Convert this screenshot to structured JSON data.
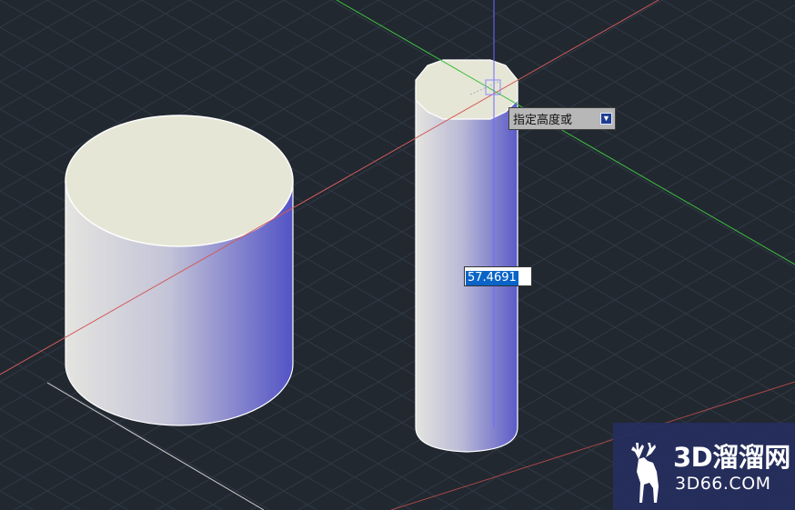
{
  "app": {
    "name": "AutoCAD 3D model space"
  },
  "command": {
    "prompt_label": "指定高度或",
    "prompt_options_icon": "chevron-down-icon",
    "height_value": "57.4691"
  },
  "scene": {
    "background_color": "#212830",
    "axis_x_color": "#d35a5a",
    "axis_y_color": "#3fbf3f",
    "axis_z_color": "#6a6aff",
    "cylinder_top_color": "#e6e6d6",
    "cylinder_light_color": "#e2e2df",
    "cylinder_dark_color": "#5656c8",
    "objects": [
      "cylinder-large",
      "cylinder-tall"
    ]
  },
  "watermark": {
    "title": "3D溜溜网",
    "subtitle": "3D66.COM",
    "logo_icon": "deer-icon"
  }
}
